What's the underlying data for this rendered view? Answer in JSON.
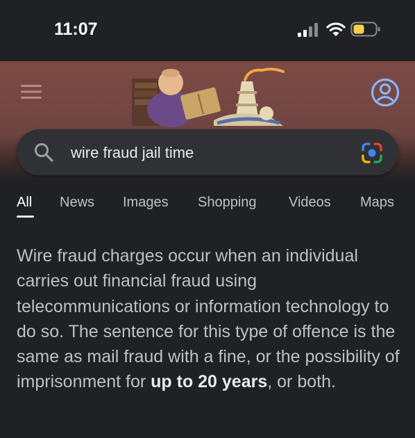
{
  "status_bar": {
    "time": "11:07",
    "signal_icon": "cellular-signal-icon",
    "wifi_icon": "wifi-icon",
    "battery_icon": "battery-icon",
    "battery_color": "#f5d34a"
  },
  "header": {
    "menu_icon": "hamburger-menu-icon",
    "doodle": "google-doodle",
    "account_icon": "account-circle-icon",
    "accent_color": "#8ab4f8"
  },
  "search": {
    "query": "wire fraud jail time",
    "search_icon": "search-icon",
    "lens_icon": "google-lens-icon"
  },
  "tabs": [
    {
      "label": "All",
      "active": true
    },
    {
      "label": "News"
    },
    {
      "label": "Images"
    },
    {
      "label": "Shopping"
    },
    {
      "label": "Videos"
    },
    {
      "label": "Maps"
    }
  ],
  "snippet": {
    "text_before": "Wire fraud charges occur when an individual carries out financial fraud using telecommunications or information technology to do so. The sentence for this type of offence is the same as mail fraud with a fine, or the possibility of imprisonment for ",
    "highlight": "up to 20 years",
    "text_after": ", or both."
  }
}
